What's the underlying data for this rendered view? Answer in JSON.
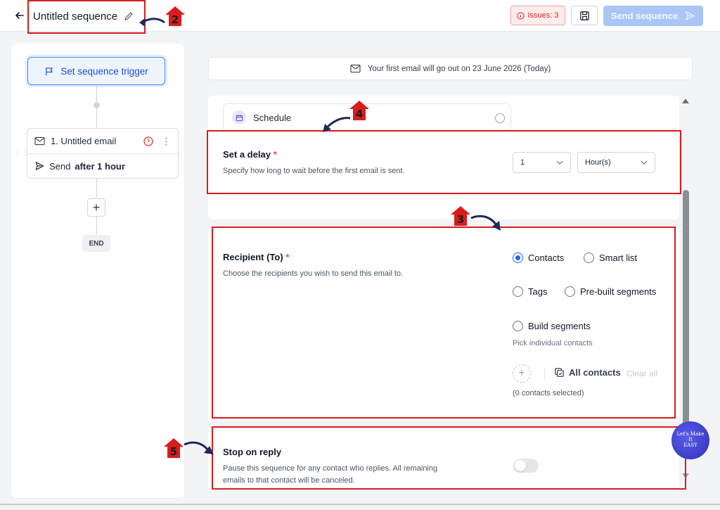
{
  "header": {
    "title": "Untitled sequence",
    "issues_label": "Issues: 3",
    "send_label": "Send sequence"
  },
  "sidebar": {
    "trigger_label": "Set sequence trigger",
    "email_title": "1. Untitled email",
    "send_prefix": "Send",
    "send_timing": "after 1 hour",
    "end_label": "END"
  },
  "banner": {
    "text": "Your first email will go out on 23 June 2026 (Today)"
  },
  "schedule": {
    "tab_label": "Schedule"
  },
  "delay": {
    "title": "Set a delay",
    "required_mark": "*",
    "description": "Specify how long to wait before the first email is sent.",
    "amount": "1",
    "unit": "Hour(s)"
  },
  "recipient": {
    "title": "Recipient (To)",
    "required_mark": "*",
    "description": "Choose the recipients you wish to send this email to.",
    "options": [
      "Contacts",
      "Smart list",
      "Tags",
      "Pre-built segments",
      "Build segments"
    ],
    "selected": "Contacts",
    "hint": "Pick individual contacts",
    "all_contacts_label": "All contacts",
    "clear_all_label": "Clear all",
    "count_text": "(0 contacts selected)"
  },
  "stop_on_reply": {
    "title": "Stop on reply",
    "description_line1": "Pause this sequence for any contact who replies. All remaining",
    "description_line2": "emails to that contact will be canceled.",
    "enabled": false
  },
  "annotations": {
    "markers": [
      "2",
      "4",
      "3",
      "5"
    ]
  },
  "watermark": {
    "line1": "Let's Make",
    "line2": "It",
    "line3": "EASY"
  },
  "colors": {
    "accent": "#2563eb",
    "annotation_red": "#d91c1c",
    "send_disabled": "#a9c6f7",
    "issues_red": "#dc2626"
  }
}
